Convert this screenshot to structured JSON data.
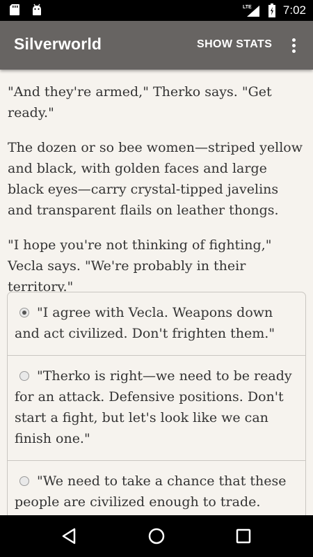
{
  "status_bar": {
    "time": "7:02",
    "network_label": "LTE",
    "icons": [
      "sd-card-icon",
      "android-icon",
      "lte-signal-icon",
      "battery-icon"
    ]
  },
  "app_bar": {
    "title": "Silverworld",
    "show_stats_label": "SHOW STATS",
    "overflow_icon": "more-vert-icon"
  },
  "story": {
    "paragraphs": [
      "\"And they're armed,\" Therko says. \"Get ready.\"",
      "The dozen or so bee women—striped yellow and black, with golden faces and large black eyes—carry crystal-tipped javelins and transparent flails on leather thongs.",
      "\"I hope you're not thinking of fighting,\" Vecla says. \"We're probably in their territory.\""
    ],
    "choices": [
      {
        "text": "\"I agree with Vecla. Weapons down and act civilized. Don't frighten them.\"",
        "selected": true
      },
      {
        "text": "\"Therko is right—we need to be ready for an attack. Defensive positions. Don't start a fight, but let's look like we can finish one.\"",
        "selected": false
      },
      {
        "text": "\"We need to take a chance that these people are civilized enough to trade.",
        "selected": false
      }
    ]
  },
  "nav_bar": {
    "icons": [
      "back-icon",
      "home-icon",
      "recents-icon"
    ]
  },
  "colors": {
    "app_bar": "#676462",
    "background": "#f6f3ee",
    "text": "#333333",
    "status_bar": "#000000"
  }
}
